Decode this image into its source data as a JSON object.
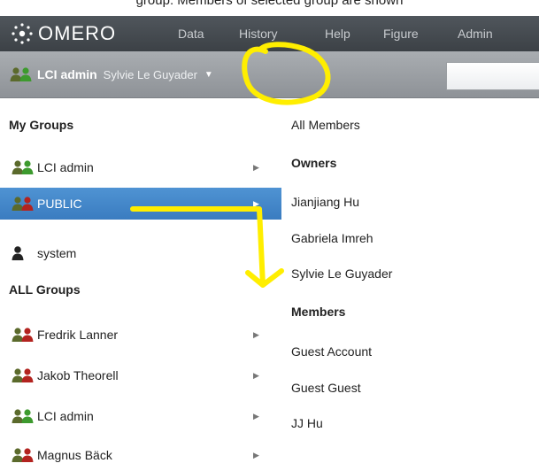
{
  "caption": "group: Members of selected group are shown",
  "app": {
    "brand": "OMERO"
  },
  "nav": [
    "Data",
    "History",
    "Help",
    "Figure",
    "Admin"
  ],
  "group_switcher": {
    "group": "LCI admin",
    "user": "Sylvie Le Guyader"
  },
  "dropdown": {
    "my_groups_heading": "My Groups",
    "my_groups": [
      {
        "label": "LCI admin",
        "icon": "green-users-icon"
      },
      {
        "label": "PUBLIC",
        "icon": "red-users-icon",
        "selected": true
      },
      {
        "label": "system",
        "icon": "single-user-icon"
      }
    ],
    "all_groups_heading": "ALL Groups",
    "all_groups": [
      {
        "label": "Fredrik Lanner",
        "icon": "red-users-icon"
      },
      {
        "label": "Jakob Theorell",
        "icon": "red-users-icon"
      },
      {
        "label": "LCI admin",
        "icon": "green-users-icon"
      },
      {
        "label": "Magnus Bäck",
        "icon": "red-users-icon"
      }
    ]
  },
  "members_panel": {
    "all_members": "All Members",
    "owners_heading": "Owners",
    "owners": [
      "Jianjiang Hu",
      "Gabriela Imreh",
      "Sylvie Le Guyader"
    ],
    "members_heading": "Members",
    "members": [
      "Guest Account",
      "Guest Guest",
      "JJ Hu"
    ]
  },
  "colors": {
    "topbar": "#45494e",
    "selection": "#3e81c4",
    "annotation": "#ffee00",
    "group_red": "#b3231f",
    "group_green": "#3d9a2e"
  }
}
